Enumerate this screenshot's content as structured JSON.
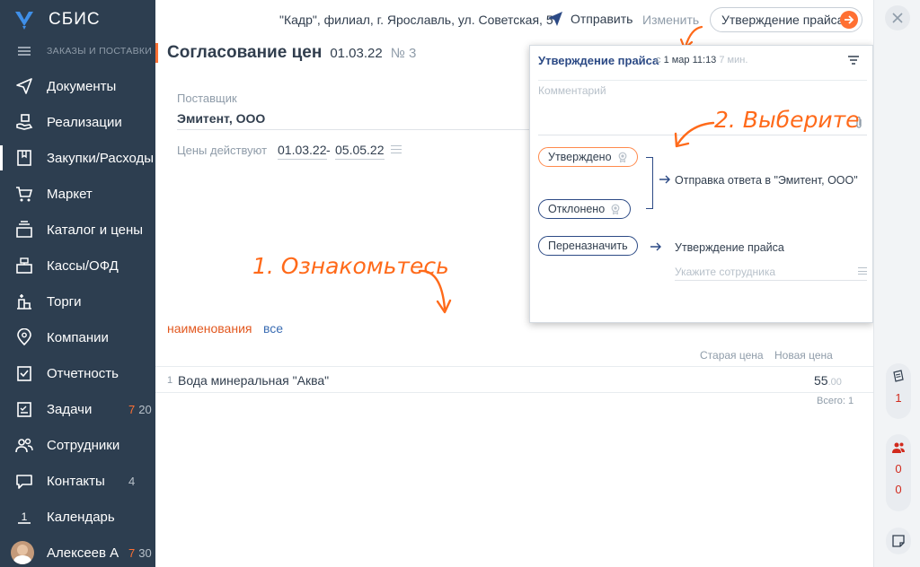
{
  "sidebar": {
    "logo_text": "СБИС",
    "section_label": "ЗАКАЗЫ И ПОСТАВКИ",
    "items": [
      {
        "label": "Документы",
        "count": ""
      },
      {
        "label": "Реализации",
        "count": ""
      },
      {
        "label": "Закупки/Расходы",
        "count": ""
      },
      {
        "label": "Маркет",
        "count": ""
      },
      {
        "label": "Каталог и цены",
        "count": ""
      },
      {
        "label": "Кассы/ОФД",
        "count": ""
      },
      {
        "label": "Торги",
        "count": ""
      },
      {
        "label": "Компании",
        "count": ""
      },
      {
        "label": "Отчетность",
        "count": ""
      },
      {
        "label": "Задачи",
        "count_hot": "7",
        "count": "20"
      },
      {
        "label": "Сотрудники",
        "count": ""
      },
      {
        "label": "Контакты",
        "count": "4"
      },
      {
        "label": "Календарь",
        "count": ""
      },
      {
        "label": "Алексеев А",
        "count_hot": "7",
        "count": "30"
      }
    ],
    "calendar_day": "1"
  },
  "topbar": {
    "company": "\"Кадр\", филиал, г. Ярославль, ул. Советская, 5",
    "send_label": "Отправить",
    "edit_label": "Изменить",
    "approve_label": "Утверждение прайса"
  },
  "document": {
    "title": "Согласование цен",
    "date": "01.03.22",
    "number": "№ 3",
    "supplier_label": "Поставщик",
    "supplier": "Эмитент, ООО",
    "prices_label": "Цены действуют",
    "date_from": "01.03.22",
    "date_dash": "-",
    "date_to": "05.05.22",
    "tab_names": "наименования",
    "tab_all": "все",
    "col_old": "Старая цена",
    "col_new": "Новая цена",
    "rows": [
      {
        "num": "1",
        "name": "Вода минеральная \"Аква\"",
        "price": "55",
        "cents": ".00"
      }
    ],
    "total": "Всего: 1"
  },
  "hints": {
    "step1": "1. Ознакомьтесь",
    "step2": "2. Выберите"
  },
  "popup": {
    "title": "Утверждение прайса",
    "time_prefix": "с",
    "time": "1 мар 11:13",
    "time_ago": "7 мин.",
    "comment_placeholder": "Комментарий",
    "approved_label": "Утверждено",
    "rejected_label": "Отклонено",
    "reassign_label": "Переназначить",
    "send_reply": "Отправка ответа в \"Эмитент, ООО\"",
    "reassign_target": "Утверждение прайса",
    "employee_placeholder": "Укажите сотрудника"
  },
  "rail": {
    "count1": "1",
    "count2": "0",
    "count3": "0"
  },
  "colors": {
    "sidebar_bg": "#2d3e50",
    "accent": "#ff7033",
    "link": "#3a6cb3",
    "title_blue": "#2c4a85"
  }
}
